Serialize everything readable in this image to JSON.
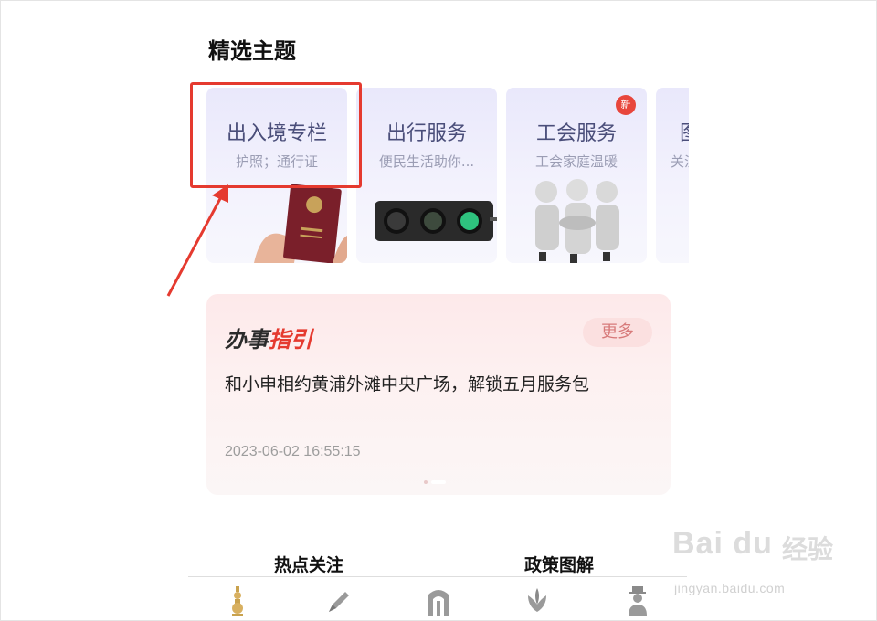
{
  "section": {
    "title": "精选主题"
  },
  "cards": [
    {
      "title": "出入境专栏",
      "subtitle": "护照；通行证",
      "art": "passport-icon"
    },
    {
      "title": "出行服务",
      "subtitle": "便民生活助你...",
      "art": "traffic-light-icon"
    },
    {
      "title": "工会服务",
      "subtitle": "工会家庭温暖",
      "art": "people-handshake-icon",
      "badge": "新"
    },
    {
      "title": "图",
      "subtitle": "关注",
      "art": ""
    }
  ],
  "guide": {
    "title_part1": "办事",
    "title_part2": "指引",
    "more_label": "更多",
    "headline": "和小申相约黄浦外滩中央广场，解锁五月服务包",
    "timestamp": "2023-06-02 16:55:15"
  },
  "bottom_tabs": {
    "left": "热点关注",
    "right": "政策图解"
  },
  "tabbar": [
    "pagoda-icon",
    "pen-icon",
    "arch-gate-icon",
    "flower-icon",
    "person-icon"
  ],
  "watermark": {
    "logo": "Bai du",
    "label": "经验",
    "url": "jingyan.baidu.com"
  },
  "colors": {
    "highlight": "#e53a2f",
    "card_title": "#4a4e7a",
    "accent_red": "#e53a2f"
  }
}
